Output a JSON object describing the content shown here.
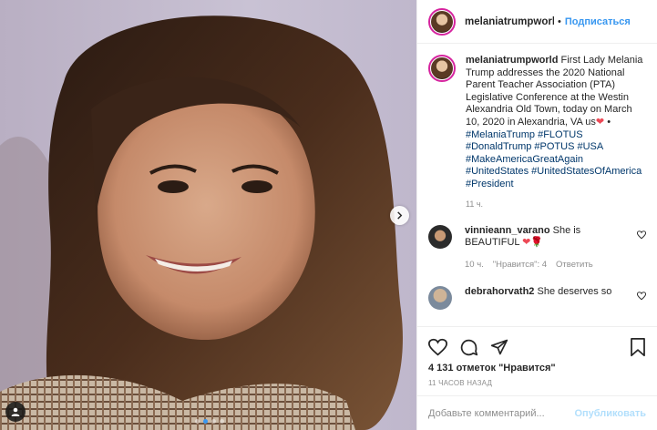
{
  "post": {
    "username": "melaniatrumpworld",
    "follow_label": "Подписаться",
    "header_separator": "•"
  },
  "caption": {
    "username": "melaniatrumpworld",
    "text": "First Lady Melania Trump addresses the 2020 National Parent Teacher Association (PTA) Legislative Conference at the Westin Alexandria Old Town, today on March 10, 2020 in Alexandria, VA us",
    "heart_emoji": "❤",
    "bullet": "•",
    "hashtags": [
      "#MelaniaTrump",
      "#FLOTUS",
      "#DonaldTrump",
      "#POTUS",
      "#USA",
      "#MakeAmericaGreatAgain",
      "#UnitedStates",
      "#UnitedStatesOfAmerica",
      "#President"
    ],
    "time": "11 ч."
  },
  "comments": [
    {
      "username": "vinnieann_varano",
      "text": "She is BEAUTIFUL",
      "emoji": "❤🌹",
      "time": "10 ч.",
      "likes": "\"Нравится\": 4",
      "reply": "Ответить"
    },
    {
      "username": "debrahorvath2",
      "text": "She deserves so"
    }
  ],
  "actions": {
    "likes_count": "4 131 отметок",
    "likes_word": "\"Нравится\"",
    "posted": "11 ЧАСОВ НАЗАД"
  },
  "add_comment": {
    "placeholder": "Добавьте комментарий...",
    "publish": "Опубликовать"
  },
  "carousel": {
    "slide_count": 4,
    "active_index": 1
  },
  "colors": {
    "accent": "#3897f0",
    "hashtag": "#00376b",
    "heart_red": "#ed4956",
    "muted": "#8e8e8e"
  },
  "icons": [
    "tag-user-icon",
    "chevron-right-icon",
    "heart-icon",
    "comment-icon",
    "share-icon",
    "bookmark-icon"
  ]
}
